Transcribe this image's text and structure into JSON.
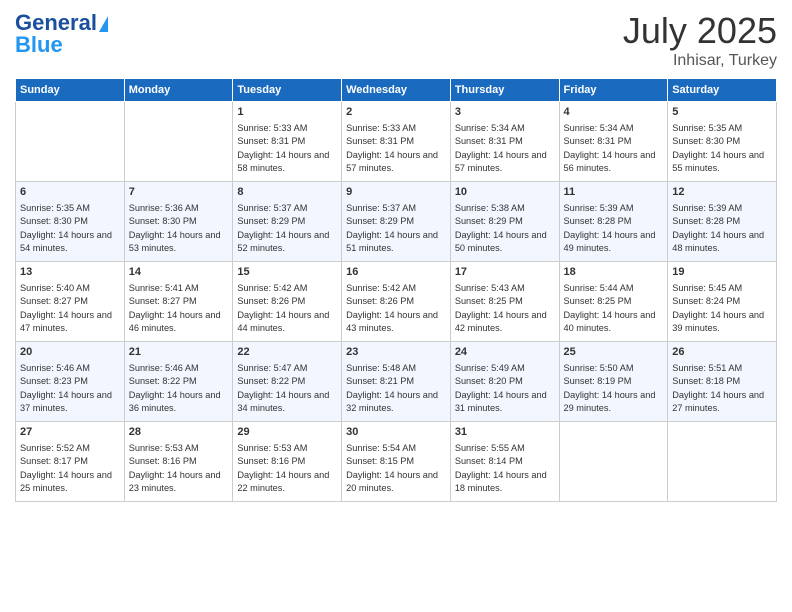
{
  "header": {
    "logo_general": "General",
    "logo_blue": "Blue",
    "month_year": "July 2025",
    "location": "Inhisar, Turkey"
  },
  "weekdays": [
    "Sunday",
    "Monday",
    "Tuesday",
    "Wednesday",
    "Thursday",
    "Friday",
    "Saturday"
  ],
  "weeks": [
    [
      {
        "day": "",
        "sunrise": "",
        "sunset": "",
        "daylight": ""
      },
      {
        "day": "",
        "sunrise": "",
        "sunset": "",
        "daylight": ""
      },
      {
        "day": "1",
        "sunrise": "Sunrise: 5:33 AM",
        "sunset": "Sunset: 8:31 PM",
        "daylight": "Daylight: 14 hours and 58 minutes."
      },
      {
        "day": "2",
        "sunrise": "Sunrise: 5:33 AM",
        "sunset": "Sunset: 8:31 PM",
        "daylight": "Daylight: 14 hours and 57 minutes."
      },
      {
        "day": "3",
        "sunrise": "Sunrise: 5:34 AM",
        "sunset": "Sunset: 8:31 PM",
        "daylight": "Daylight: 14 hours and 57 minutes."
      },
      {
        "day": "4",
        "sunrise": "Sunrise: 5:34 AM",
        "sunset": "Sunset: 8:31 PM",
        "daylight": "Daylight: 14 hours and 56 minutes."
      },
      {
        "day": "5",
        "sunrise": "Sunrise: 5:35 AM",
        "sunset": "Sunset: 8:30 PM",
        "daylight": "Daylight: 14 hours and 55 minutes."
      }
    ],
    [
      {
        "day": "6",
        "sunrise": "Sunrise: 5:35 AM",
        "sunset": "Sunset: 8:30 PM",
        "daylight": "Daylight: 14 hours and 54 minutes."
      },
      {
        "day": "7",
        "sunrise": "Sunrise: 5:36 AM",
        "sunset": "Sunset: 8:30 PM",
        "daylight": "Daylight: 14 hours and 53 minutes."
      },
      {
        "day": "8",
        "sunrise": "Sunrise: 5:37 AM",
        "sunset": "Sunset: 8:29 PM",
        "daylight": "Daylight: 14 hours and 52 minutes."
      },
      {
        "day": "9",
        "sunrise": "Sunrise: 5:37 AM",
        "sunset": "Sunset: 8:29 PM",
        "daylight": "Daylight: 14 hours and 51 minutes."
      },
      {
        "day": "10",
        "sunrise": "Sunrise: 5:38 AM",
        "sunset": "Sunset: 8:29 PM",
        "daylight": "Daylight: 14 hours and 50 minutes."
      },
      {
        "day": "11",
        "sunrise": "Sunrise: 5:39 AM",
        "sunset": "Sunset: 8:28 PM",
        "daylight": "Daylight: 14 hours and 49 minutes."
      },
      {
        "day": "12",
        "sunrise": "Sunrise: 5:39 AM",
        "sunset": "Sunset: 8:28 PM",
        "daylight": "Daylight: 14 hours and 48 minutes."
      }
    ],
    [
      {
        "day": "13",
        "sunrise": "Sunrise: 5:40 AM",
        "sunset": "Sunset: 8:27 PM",
        "daylight": "Daylight: 14 hours and 47 minutes."
      },
      {
        "day": "14",
        "sunrise": "Sunrise: 5:41 AM",
        "sunset": "Sunset: 8:27 PM",
        "daylight": "Daylight: 14 hours and 46 minutes."
      },
      {
        "day": "15",
        "sunrise": "Sunrise: 5:42 AM",
        "sunset": "Sunset: 8:26 PM",
        "daylight": "Daylight: 14 hours and 44 minutes."
      },
      {
        "day": "16",
        "sunrise": "Sunrise: 5:42 AM",
        "sunset": "Sunset: 8:26 PM",
        "daylight": "Daylight: 14 hours and 43 minutes."
      },
      {
        "day": "17",
        "sunrise": "Sunrise: 5:43 AM",
        "sunset": "Sunset: 8:25 PM",
        "daylight": "Daylight: 14 hours and 42 minutes."
      },
      {
        "day": "18",
        "sunrise": "Sunrise: 5:44 AM",
        "sunset": "Sunset: 8:25 PM",
        "daylight": "Daylight: 14 hours and 40 minutes."
      },
      {
        "day": "19",
        "sunrise": "Sunrise: 5:45 AM",
        "sunset": "Sunset: 8:24 PM",
        "daylight": "Daylight: 14 hours and 39 minutes."
      }
    ],
    [
      {
        "day": "20",
        "sunrise": "Sunrise: 5:46 AM",
        "sunset": "Sunset: 8:23 PM",
        "daylight": "Daylight: 14 hours and 37 minutes."
      },
      {
        "day": "21",
        "sunrise": "Sunrise: 5:46 AM",
        "sunset": "Sunset: 8:22 PM",
        "daylight": "Daylight: 14 hours and 36 minutes."
      },
      {
        "day": "22",
        "sunrise": "Sunrise: 5:47 AM",
        "sunset": "Sunset: 8:22 PM",
        "daylight": "Daylight: 14 hours and 34 minutes."
      },
      {
        "day": "23",
        "sunrise": "Sunrise: 5:48 AM",
        "sunset": "Sunset: 8:21 PM",
        "daylight": "Daylight: 14 hours and 32 minutes."
      },
      {
        "day": "24",
        "sunrise": "Sunrise: 5:49 AM",
        "sunset": "Sunset: 8:20 PM",
        "daylight": "Daylight: 14 hours and 31 minutes."
      },
      {
        "day": "25",
        "sunrise": "Sunrise: 5:50 AM",
        "sunset": "Sunset: 8:19 PM",
        "daylight": "Daylight: 14 hours and 29 minutes."
      },
      {
        "day": "26",
        "sunrise": "Sunrise: 5:51 AM",
        "sunset": "Sunset: 8:18 PM",
        "daylight": "Daylight: 14 hours and 27 minutes."
      }
    ],
    [
      {
        "day": "27",
        "sunrise": "Sunrise: 5:52 AM",
        "sunset": "Sunset: 8:17 PM",
        "daylight": "Daylight: 14 hours and 25 minutes."
      },
      {
        "day": "28",
        "sunrise": "Sunrise: 5:53 AM",
        "sunset": "Sunset: 8:16 PM",
        "daylight": "Daylight: 14 hours and 23 minutes."
      },
      {
        "day": "29",
        "sunrise": "Sunrise: 5:53 AM",
        "sunset": "Sunset: 8:16 PM",
        "daylight": "Daylight: 14 hours and 22 minutes."
      },
      {
        "day": "30",
        "sunrise": "Sunrise: 5:54 AM",
        "sunset": "Sunset: 8:15 PM",
        "daylight": "Daylight: 14 hours and 20 minutes."
      },
      {
        "day": "31",
        "sunrise": "Sunrise: 5:55 AM",
        "sunset": "Sunset: 8:14 PM",
        "daylight": "Daylight: 14 hours and 18 minutes."
      },
      {
        "day": "",
        "sunrise": "",
        "sunset": "",
        "daylight": ""
      },
      {
        "day": "",
        "sunrise": "",
        "sunset": "",
        "daylight": ""
      }
    ]
  ]
}
